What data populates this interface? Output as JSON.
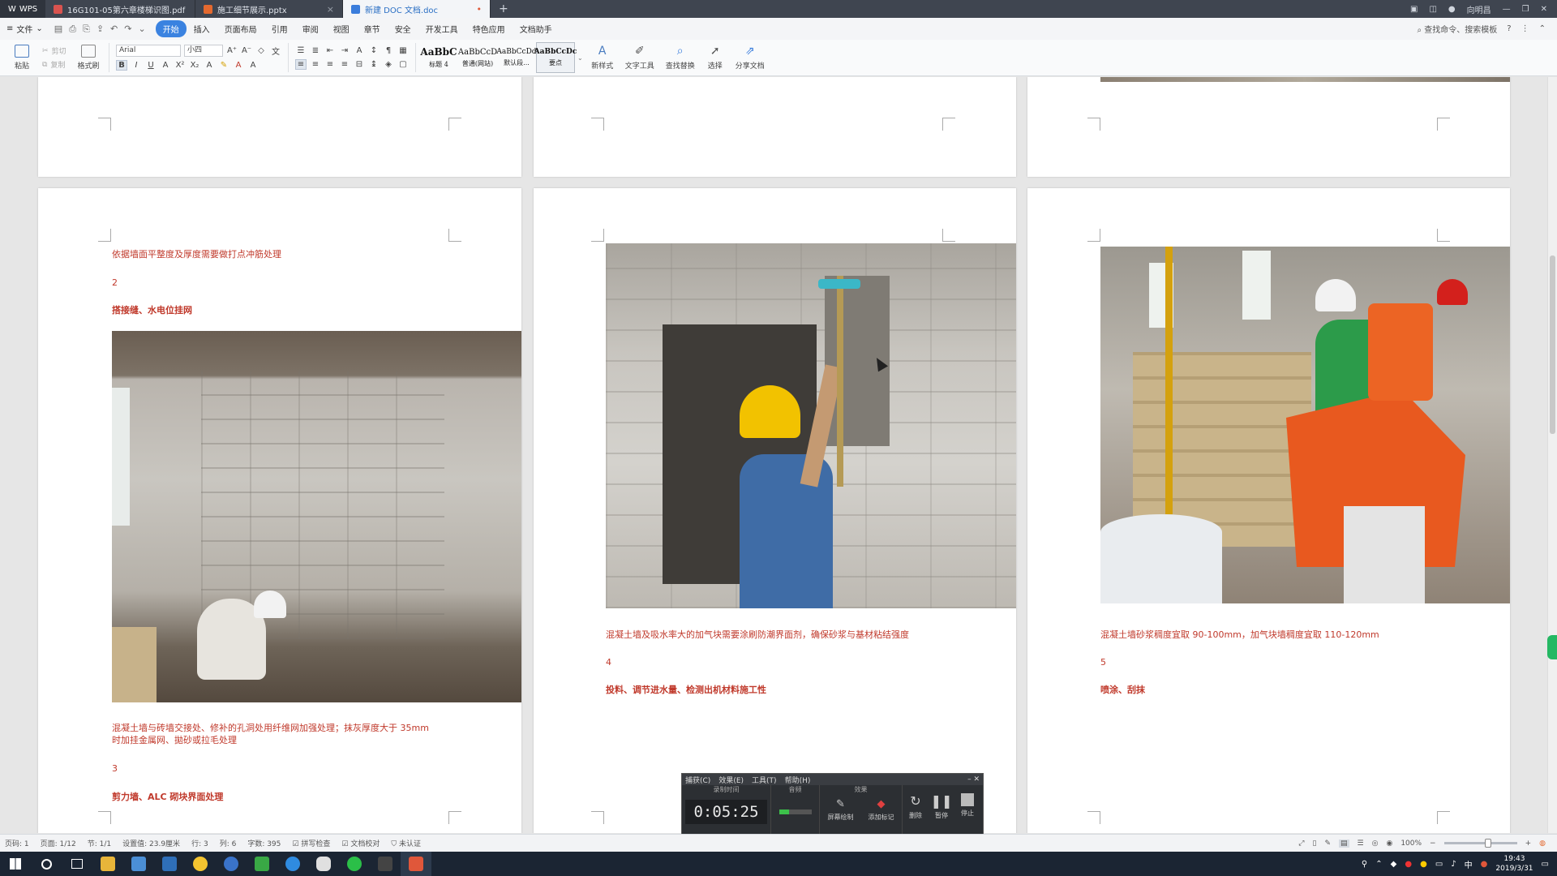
{
  "titlebar": {
    "logo": "WPS",
    "tabs": [
      {
        "label": "16G101-05第六章楼梯识图.pdf",
        "color": "#d9534f"
      },
      {
        "label": "施工细节展示.pptx",
        "color": "#e4692f"
      },
      {
        "label": "新建 DOC 文档.doc",
        "color": "#3a7ddc"
      }
    ],
    "new_tab": "+",
    "user": "向明昌"
  },
  "menubar": {
    "file": "文件",
    "items": [
      "开始",
      "插入",
      "页面布局",
      "引用",
      "审阅",
      "视图",
      "章节",
      "安全",
      "开发工具",
      "特色应用",
      "文档助手"
    ],
    "active": "开始",
    "search": "查找命令、搜索模板"
  },
  "ribbon": {
    "paste": "粘贴",
    "cut": "剪切",
    "copy": "复制",
    "format_painter": "格式刷",
    "font_name": "Arial",
    "font_size": "小四",
    "styles": [
      {
        "title": "AaBbC",
        "sub": "标题 4"
      },
      {
        "title": "AaBbCcD",
        "sub": "普通(网站)"
      },
      {
        "title": "AaBbCcDd",
        "sub": "默认段..."
      },
      {
        "title": "AaBbCcDc",
        "sub": "要点"
      }
    ],
    "new_style": "新样式",
    "text_tools": "文字工具",
    "find_replace": "查找替换",
    "select": "选择",
    "share": "分享文档"
  },
  "document": {
    "col1": {
      "p1": "依据墙面平整度及厚度需要做打点冲筋处理",
      "n2": "2",
      "h2": "搭接缝、水电位挂网",
      "p2a": "混凝土墙与砖墙交接处、修补的孔洞处用纤维网加强处理；抹灰厚度大于 35mm",
      "p2b": "时加挂金属网、拋砂或拉毛处理",
      "n3": "3",
      "h3": "剪力墙、ALC 砌块界面处理"
    },
    "col2": {
      "p1": "混凝土墙及吸水率大的加气块需要涂刷防潮界面剂，确保砂浆与基材粘结强度",
      "n4": "4",
      "h4": "投料、调节进水量、检测出机材料施工性"
    },
    "col3": {
      "p1": "混凝土墙砂浆稠度宜取 90-100mm，加气块墙稠度宜取 110-120mm",
      "n5": "5",
      "h5": "喷涂、刮抹"
    }
  },
  "recorder": {
    "menu": [
      "捕获(C)",
      "效果(E)",
      "工具(T)",
      "帮助(H)"
    ],
    "time_label": "录制时间",
    "audio_label": "音频",
    "effect_label": "效果",
    "time": "0:05:25",
    "buttons": [
      "屏幕绘制",
      "添加标记",
      "删除",
      "暂停",
      "停止"
    ]
  },
  "statusbar": {
    "page_num": "页码: 1",
    "pages": "页面: 1/12",
    "section": "节: 1/1",
    "setting": "设置值: 23.9厘米",
    "row": "行: 3",
    "col": "列: 6",
    "words": "字数: 395",
    "spell": "拼写检查",
    "proof": "文档校对",
    "cert": "未认证",
    "zoom": "100%"
  },
  "taskbar": {
    "time": "19:43",
    "date": "2019/3/31",
    "ime": "中"
  }
}
